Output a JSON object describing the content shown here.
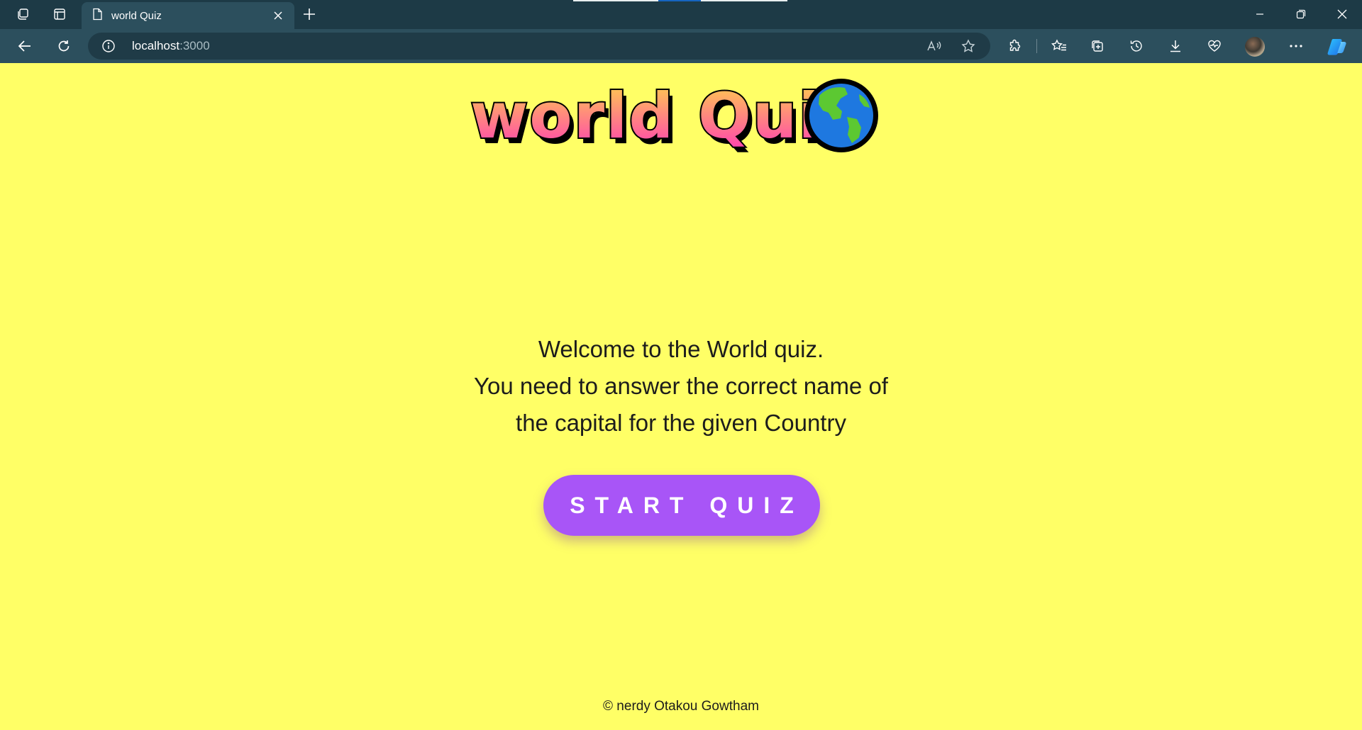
{
  "browser": {
    "tab": {
      "title": "world Quiz",
      "icon": "page-icon"
    },
    "address": {
      "host": "localhost",
      "port": ":3000"
    },
    "icons": {
      "workspaces": "workspaces-icon",
      "tab_actions": "tab-actions-icon",
      "new_tab": "plus-icon",
      "back": "back-arrow-icon",
      "refresh": "refresh-icon",
      "site_info": "info-icon",
      "read_aloud": "read-aloud-icon",
      "favorite": "star-icon",
      "extensions": "puzzle-icon",
      "favorites": "favorites-icon",
      "collections": "collections-icon",
      "history": "history-icon",
      "downloads": "download-icon",
      "browser_essentials": "heart-pulse-icon",
      "profile": "avatar",
      "more": "more-dots-icon",
      "copilot": "copilot-icon",
      "minimize": "minimize-icon",
      "restore": "restore-icon",
      "close": "close-icon"
    },
    "colors": {
      "titlebar": "#1d3a46",
      "toolbar": "#2c4f5d"
    }
  },
  "page": {
    "logo": {
      "text": "world Quiz",
      "emoji_icon": "globe-americas-icon"
    },
    "welcome": {
      "line1": "Welcome to the World quiz.",
      "line2": "You need to answer the correct name of",
      "line3": "the capital for the given Country"
    },
    "start_button": "START QUIZ",
    "footer": "© nerdy Otakou Gowtham",
    "colors": {
      "background": "#ffff66",
      "button": "#a855f7",
      "logo_gradient_top": "#ffd24a",
      "logo_gradient_bottom": "#ff3db4"
    }
  }
}
